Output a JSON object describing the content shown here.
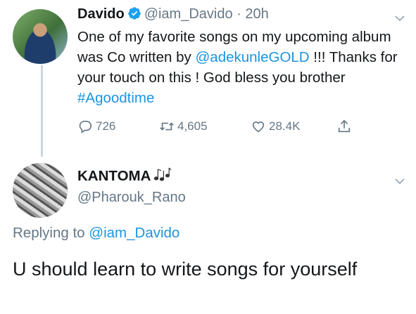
{
  "tweet": {
    "author_name": "Davido",
    "handle": "@iam_Davido",
    "separator": "·",
    "time": "20h",
    "text_part1": "One of my favorite songs on my upcoming album was Co written by ",
    "mention": "@adekunleGOLD",
    "text_part2": " !!! Thanks for your touch on this ! God bless you brother ",
    "hashtag": "#Agoodtime",
    "actions": {
      "reply_count": "726",
      "retweet_count": "4,605",
      "like_count": "28.4K"
    }
  },
  "reply": {
    "author_name": "KANTOMA",
    "handle": "@Pharouk_Rano",
    "replying_prefix": "Replying to ",
    "replying_to": "@iam_Davido",
    "text": "U should learn to write songs for yourself"
  },
  "colors": {
    "link": "#1b95e0",
    "secondary": "#657786",
    "verified": "#1da1f2",
    "thread_line": "#ccd6dd"
  },
  "icons": [
    "verified-badge-icon",
    "chevron-down-icon",
    "reply-icon",
    "retweet-icon",
    "like-icon",
    "share-icon",
    "music-notes-icon"
  ]
}
